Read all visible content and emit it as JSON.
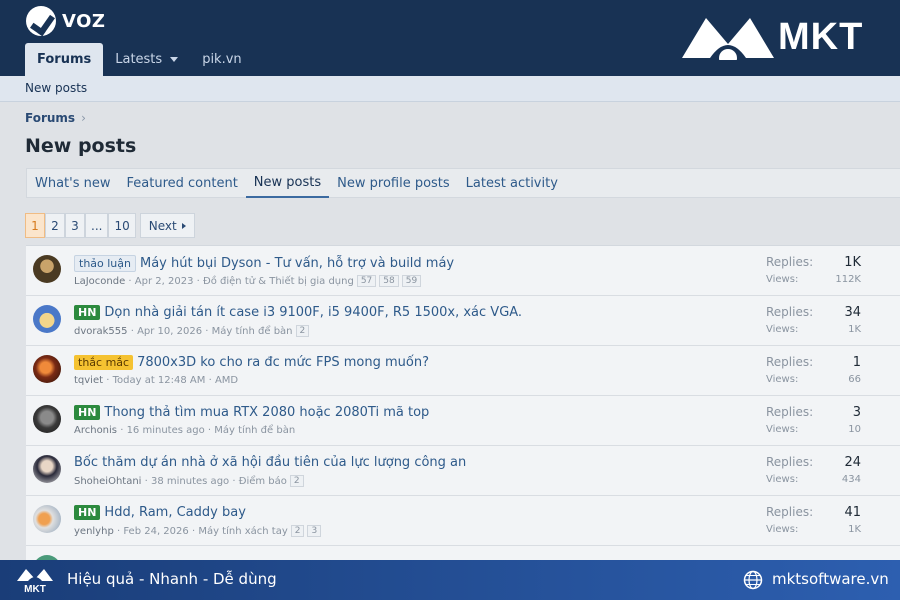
{
  "header": {
    "site_logo_text": "VOZ",
    "brand_text": "MKT",
    "nav": [
      {
        "label": "Forums"
      },
      {
        "label": "Latests"
      },
      {
        "label": "pik.vn"
      }
    ],
    "subnav_link": "New posts",
    "colors": {
      "header_bg": "#183254",
      "accent": "#d67a1e"
    }
  },
  "breadcrumb": {
    "item": "Forums"
  },
  "page_title": "New posts",
  "tabs": [
    {
      "label": "What's new"
    },
    {
      "label": "Featured content"
    },
    {
      "label": "New posts"
    },
    {
      "label": "New profile posts"
    },
    {
      "label": "Latest activity"
    }
  ],
  "pagination": {
    "pages": [
      "1",
      "2",
      "3",
      "...",
      "10"
    ],
    "current": "1",
    "next_label": "Next"
  },
  "threads": [
    {
      "prefix": "thảo luận",
      "title": "Máy hút bụi Dyson - Tư vấn, hỗ trợ và build máy",
      "author": "LaJoconde",
      "date": "Apr 2, 2023",
      "forum": "Đồ điện tử & Thiết bị gia dụng",
      "pages": [
        "57",
        "58",
        "59"
      ],
      "replies_label": "Replies:",
      "replies": "1K",
      "views_label": "Views:",
      "views": "112K"
    },
    {
      "prefix": "HN",
      "title": "Dọn nhà giải tán ít case i3 9100F, i5 9400F, R5 1500x, xác VGA.",
      "author": "dvorak555",
      "date": "Apr 10, 2026",
      "forum": "Máy tính để bàn",
      "pages": [
        "2"
      ],
      "replies_label": "Replies:",
      "replies": "34",
      "views_label": "Views:",
      "views": "1K"
    },
    {
      "prefix": "thắc mắc",
      "title": "7800x3D ko cho ra đc mức FPS mong muốn?",
      "author": "tqviet",
      "date": "Today at 12:48 AM",
      "forum": "AMD",
      "pages": [],
      "replies_label": "Replies:",
      "replies": "1",
      "views_label": "Views:",
      "views": "66"
    },
    {
      "prefix": "HN",
      "title": "Thong thả tìm mua RTX 2080 hoặc 2080Ti mã top",
      "author": "Archonis",
      "date": "16 minutes ago",
      "forum": "Máy tính để bàn",
      "pages": [],
      "replies_label": "Replies:",
      "replies": "3",
      "views_label": "Views:",
      "views": "10"
    },
    {
      "prefix": "",
      "title": "Bốc thăm dự án nhà ở xã hội đầu tiên của lực lượng công an",
      "author": "ShoheiOhtani",
      "date": "38 minutes ago",
      "forum": "Điểm báo",
      "pages": [
        "2"
      ],
      "replies_label": "Replies:",
      "replies": "24",
      "views_label": "Views:",
      "views": "434"
    },
    {
      "prefix": "HN",
      "title": "Hdd, Ram, Caddy bay",
      "author": "yenlyhp",
      "date": "Feb 24, 2026",
      "forum": "Máy tính xách tay",
      "pages": [
        "2",
        "3"
      ],
      "replies_label": "Replies:",
      "replies": "41",
      "views_label": "Views:",
      "views": "1K"
    }
  ],
  "banner": {
    "tagline": "Hiệu quả - Nhanh - Dễ dùng",
    "url": "mktsoftware.vn"
  }
}
